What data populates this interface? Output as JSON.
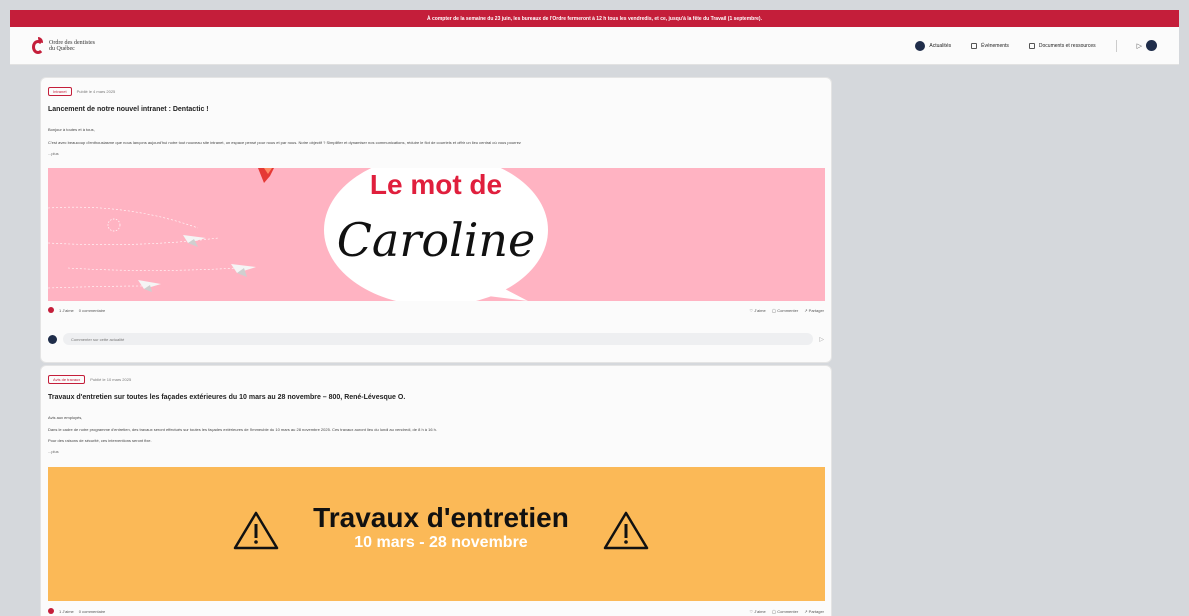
{
  "banner": {
    "text": "À compter de la semaine du 23 juin, les bureaux de l'Ordre fermeront à 12 h tous les vendredis, et ce, jusqu'à la fête du Travail (1 septembre)."
  },
  "header": {
    "logo_line1": "Ordre des dentistes",
    "logo_line2": "du Québec",
    "nav": [
      {
        "label": "Actualités",
        "icon": "news-icon",
        "active": true
      },
      {
        "label": "Événements",
        "icon": "calendar-icon"
      },
      {
        "label": "Documents et ressources",
        "icon": "document-icon"
      }
    ],
    "expand_icon": "chevron-right-icon",
    "user_initial": ""
  },
  "posts": [
    {
      "tag": "Intranet",
      "date": "Publié le 4 mars 2025",
      "title": "Lancement de notre nouvel intranet : Dentactic !",
      "greeting": "Bonjour à toutes et à tous,",
      "body": "C'est avec beaucoup d'enthousiasme que nous lançons aujourd'hui notre tout nouveau site intranet, un espace pensé pour nous et par nous. Notre objectif ? Simplifier et dynamiser nos communications, réduire le flot de courriels et offrir un lieu central où vous pourrez",
      "more": "...plus",
      "image": {
        "heading": "Le mot de",
        "script": "Caroline",
        "bg": "#ffb3c2"
      },
      "likes": "1 J'aime",
      "comments": "0 commentaire",
      "like_label": "J'aime",
      "comment_label": "Commenter",
      "share_label": "Partager",
      "comment_placeholder": "Commenter sur cette actualité"
    },
    {
      "tag": "Avis de travaux",
      "date": "Publié le 10 mars 2025",
      "title": "Travaux d'entretien sur toutes les façades extérieures du 10 mars au 28 novembre – 800, René-Lévesque O.",
      "greeting": "Avis aux employés,",
      "body": "Dans le cadre de notre programme d'entretien, des travaux seront effectués sur toutes les façades extérieures de l'immeuble du 10 mars au 28 novembre 2025. Ces travaux auront lieu du lundi au vendredi, de 8 h à 16 h.",
      "body2": "Pour des raisons de sécurité, ces interventions seront fixe.",
      "more": "...plus",
      "image": {
        "heading": "Travaux d'entretien",
        "sub": "10 mars - 28 novembre",
        "bg": "#fbb957"
      },
      "likes": "1 J'aime",
      "comments": "0 commentaire",
      "like_label": "J'aime",
      "comment_label": "Commenter",
      "share_label": "Partager"
    }
  ],
  "colors": {
    "brand": "#c41e3a",
    "navy": "#1f2d4a",
    "page_bg": "#d5d8dc"
  }
}
